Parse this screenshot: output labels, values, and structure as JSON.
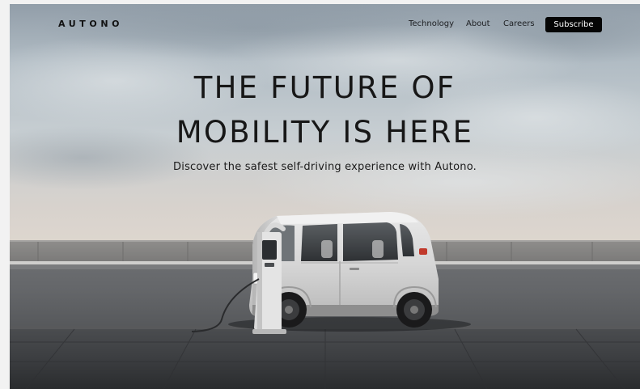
{
  "brand": {
    "logo_text": "AUTONO"
  },
  "nav": {
    "links": [
      {
        "label": "Technology"
      },
      {
        "label": "About"
      },
      {
        "label": "Careers"
      }
    ],
    "subscribe_label": "Subscribe"
  },
  "hero": {
    "title_line1": "THE FUTURE OF",
    "title_line2": "MOBILITY IS HERE",
    "subtitle": "Discover the safest self-driving experience with Autono."
  },
  "colors": {
    "button_bg": "#050505",
    "button_text": "#ffffff",
    "text_dark": "#171717"
  },
  "icons": [
    "electric-vehicle-image",
    "charging-station-image"
  ]
}
